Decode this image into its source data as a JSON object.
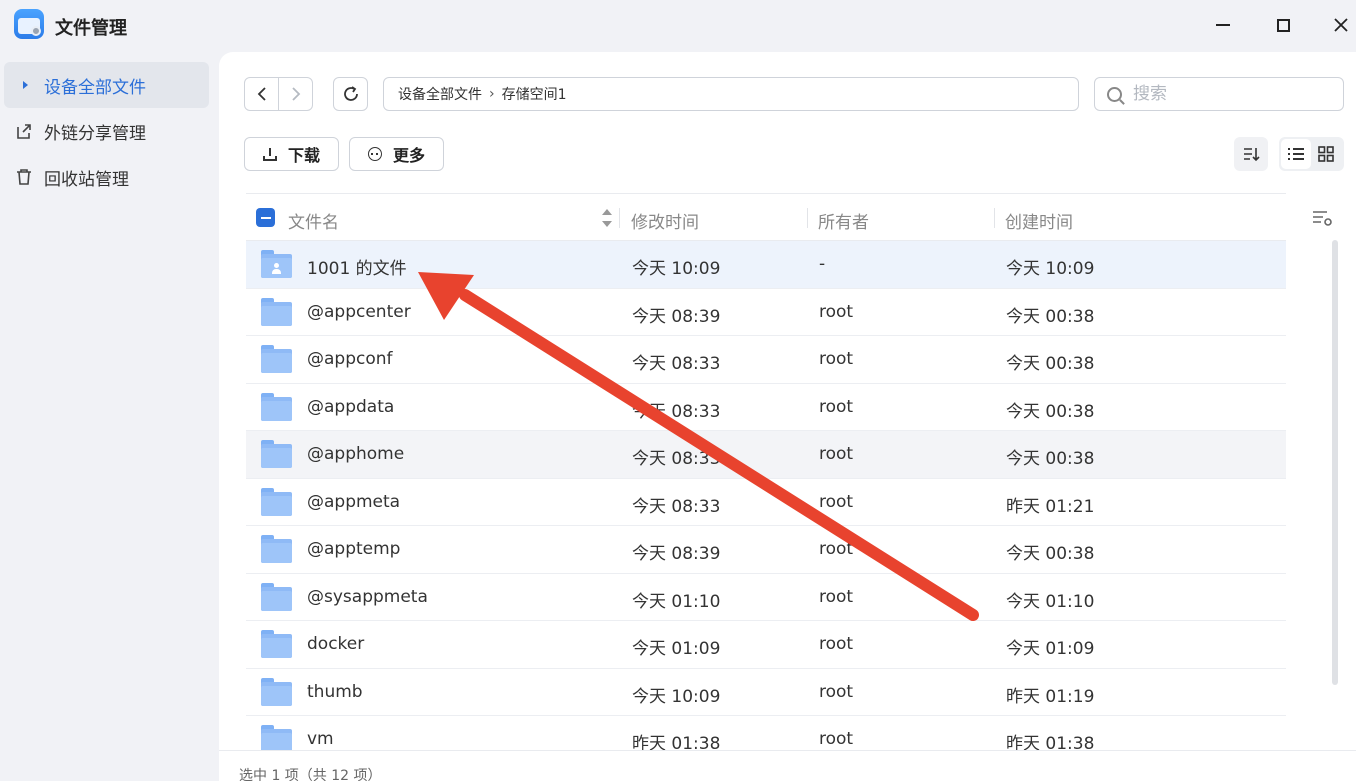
{
  "app": {
    "title": "文件管理"
  },
  "sidebar": {
    "items": [
      {
        "label": "设备全部文件",
        "icon": "caret-right-icon",
        "active": true
      },
      {
        "label": "外链分享管理",
        "icon": "share-link-icon",
        "active": false
      },
      {
        "label": "回收站管理",
        "icon": "trash-icon",
        "active": false
      }
    ]
  },
  "toolbar": {
    "breadcrumb": [
      "设备全部文件",
      "存储空间1"
    ],
    "search_placeholder": "搜索",
    "download_label": "下载",
    "more_label": "更多"
  },
  "table": {
    "columns": [
      "文件名",
      "修改时间",
      "所有者",
      "创建时间"
    ],
    "rows": [
      {
        "name": "1001 的文件",
        "modified": "今天 10:09",
        "owner": "-",
        "created": "今天 10:09",
        "icon": "user-folder-icon",
        "state": "selected"
      },
      {
        "name": "@appcenter",
        "modified": "今天 08:39",
        "owner": "root",
        "created": "今天 00:38",
        "icon": "folder-icon"
      },
      {
        "name": "@appconf",
        "modified": "今天 08:33",
        "owner": "root",
        "created": "今天 00:38",
        "icon": "folder-icon"
      },
      {
        "name": "@appdata",
        "modified": "今天 08:33",
        "owner": "root",
        "created": "今天 00:38",
        "icon": "folder-icon"
      },
      {
        "name": "@apphome",
        "modified": "今天 08:33",
        "owner": "root",
        "created": "今天 00:38",
        "icon": "folder-icon",
        "state": "hover"
      },
      {
        "name": "@appmeta",
        "modified": "今天 08:33",
        "owner": "root",
        "created": "昨天 01:21",
        "icon": "folder-icon"
      },
      {
        "name": "@apptemp",
        "modified": "今天 08:39",
        "owner": "root",
        "created": "今天 00:38",
        "icon": "folder-icon"
      },
      {
        "name": "@sysappmeta",
        "modified": "今天 01:10",
        "owner": "root",
        "created": "今天 01:10",
        "icon": "folder-icon"
      },
      {
        "name": "docker",
        "modified": "今天 01:09",
        "owner": "root",
        "created": "今天 01:09",
        "icon": "folder-icon"
      },
      {
        "name": "thumb",
        "modified": "今天 10:09",
        "owner": "root",
        "created": "昨天 01:19",
        "icon": "folder-icon"
      },
      {
        "name": "vm",
        "modified": "昨天 01:38",
        "owner": "root",
        "created": "昨天 01:38",
        "icon": "folder-icon"
      }
    ]
  },
  "footer": {
    "status": "选中 1 项（共 12 项）"
  },
  "colors": {
    "accent": "#2b6fd8",
    "annotation": "#e8432e",
    "folder": "#9ec5f9"
  }
}
